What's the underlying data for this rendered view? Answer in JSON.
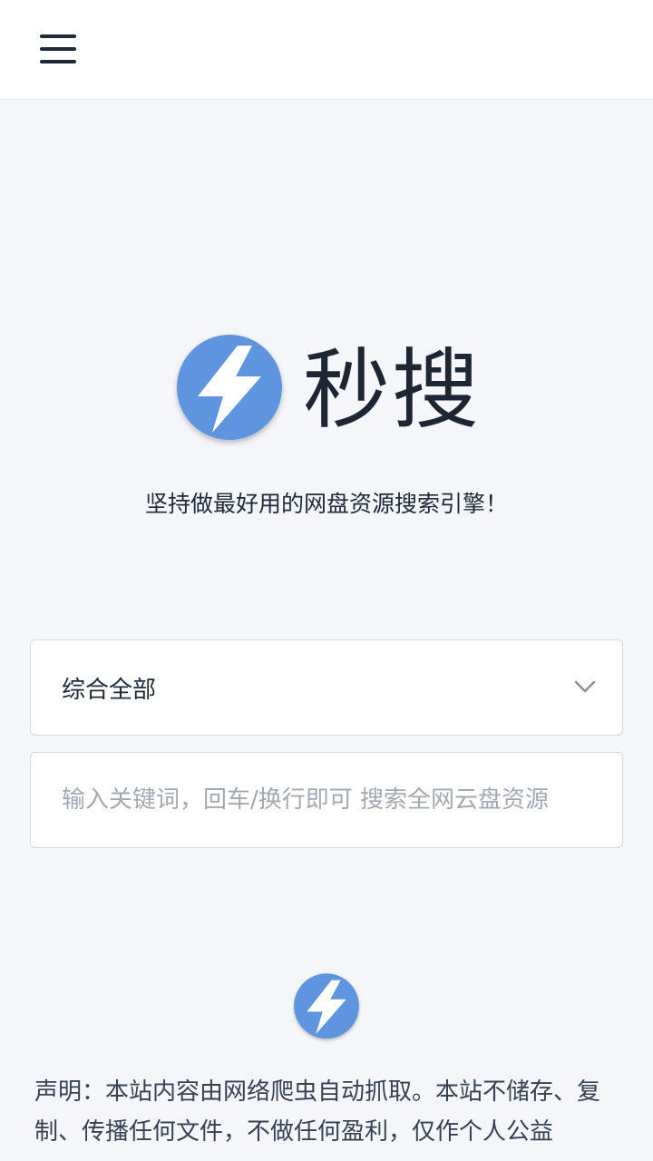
{
  "brand": {
    "name": "秒搜",
    "slogan": "坚持做最好用的网盘资源搜索引擎！",
    "logo_icon": "lightning-bolt-icon",
    "accent": "#5e95df"
  },
  "header": {
    "menu_icon": "hamburger-menu-icon"
  },
  "form": {
    "category_selected": "综合全部",
    "search_placeholder": "输入关键词，回车/换行即可 搜索全网云盘资源",
    "search_value": ""
  },
  "footer": {
    "logo_icon": "lightning-bolt-icon",
    "disclaimer": "声明：本站内容由网络爬虫自动抓取。本站不储存、复制、传播任何文件，不做任何盈利，仅作个人公益"
  }
}
